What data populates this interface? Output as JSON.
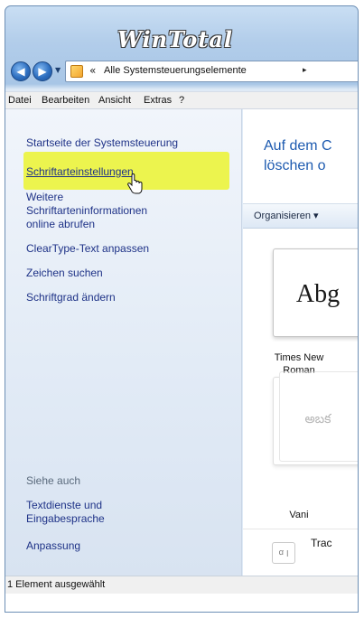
{
  "watermark": "WinTotal",
  "address": {
    "chevron": "«",
    "path": "Alle Systemsteuerungselemente",
    "arrow": "▸"
  },
  "menu": [
    "Datei",
    "Bearbeiten",
    "Ansicht",
    "Extras",
    "?"
  ],
  "sidebar": {
    "links": [
      "Startseite der Systemsteuerung",
      "Schriftarteinstellungen",
      "Weitere",
      "Schriftarteninformationen",
      "online abrufen",
      "ClearType-Text anpassen",
      "Zeichen suchen",
      "Schriftgrad ändern"
    ],
    "see_also": {
      "heading": "Siehe auch",
      "links": [
        "Textdienste und",
        "Eingabesprache",
        "Anpassung"
      ]
    }
  },
  "content": {
    "title_line1": "Auf dem C",
    "title_line2": "löschen o",
    "toolbar_label": "Organisieren ▾",
    "fonts": [
      {
        "sample": "Abg",
        "caption_line1": "Times New",
        "caption_line2": "Roman"
      },
      {
        "sample": "అబక",
        "caption_line1": "Vani",
        "caption_line2": ""
      }
    ],
    "detail_icon": "ꭤ ꞁ",
    "detail_name": "Trac"
  },
  "status": "1 Element ausgewählt",
  "colors": {
    "highlight": "#ecf44e",
    "link": "#1e3287",
    "title": "#1e5bb0"
  }
}
